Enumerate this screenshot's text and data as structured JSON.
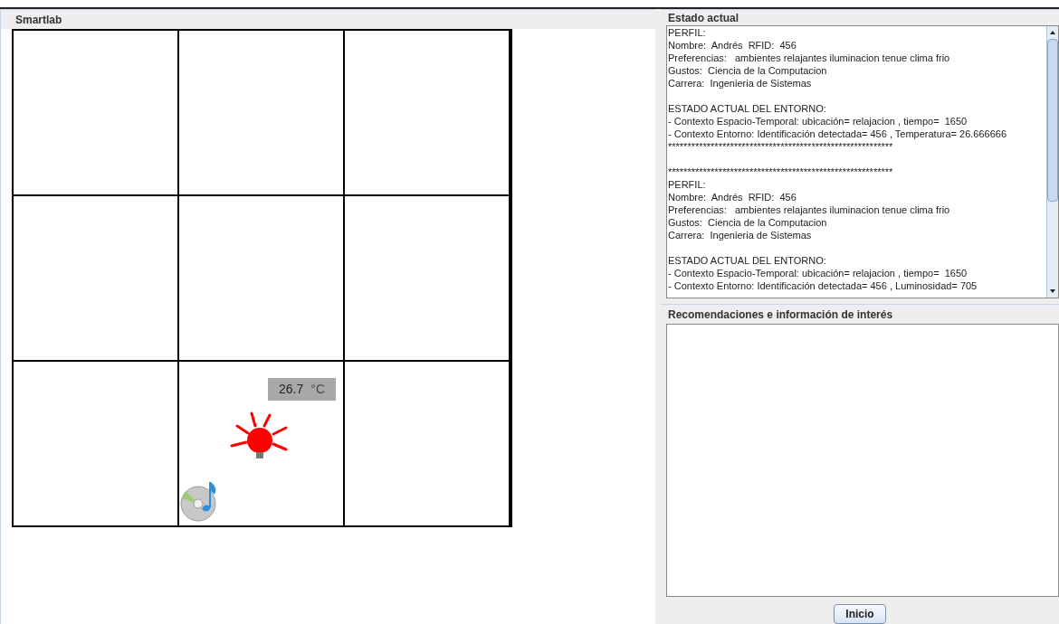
{
  "smartlab": {
    "title": "Smartlab",
    "occupied_cell": {
      "devices": [
        {
          "kind": "sensor",
          "reading": "26.7",
          "unit": "°C"
        },
        {
          "kind": "lamp",
          "on": true
        },
        {
          "kind": "music"
        }
      ]
    }
  },
  "estado": {
    "title": "Estado actual",
    "paragraphs": [
      [
        "PERFIL:",
        "Nombre:  Andrés  RFID:  456",
        "Preferencias:   ambientes relajantes iluminacion tenue clima frio",
        "Gustos:  Ciencia de la Computacion",
        "Carrera:  Ingenieria de Sistemas"
      ],
      [
        "ESTADO ACTUAL DEL ENTORNO:",
        "- Contexto Espacio-Temporal: ubicación= relajacion , tiempo=  1650",
        "- Contexto Entorno: Identificación detectada= 456 , Temperatura= 26.666666",
        "**********************************************************"
      ],
      [
        "**********************************************************",
        "PERFIL:",
        "Nombre:  Andrés  RFID:  456",
        "Preferencias:   ambientes relajantes iluminacion tenue clima frio",
        "Gustos:  Ciencia de la Computacion",
        "Carrera:  Ingenieria de Sistemas"
      ],
      [
        "ESTADO ACTUAL DEL ENTORNO:",
        "- Contexto Espacio-Temporal: ubicación= relajacion , tiempo=  1650",
        "- Contexto Entorno: Identificación detectada= 456 , Luminosidad= 705"
      ]
    ]
  },
  "recomendaciones": {
    "title": "Recomendaciones e información de interés"
  },
  "button": "Inicio"
}
